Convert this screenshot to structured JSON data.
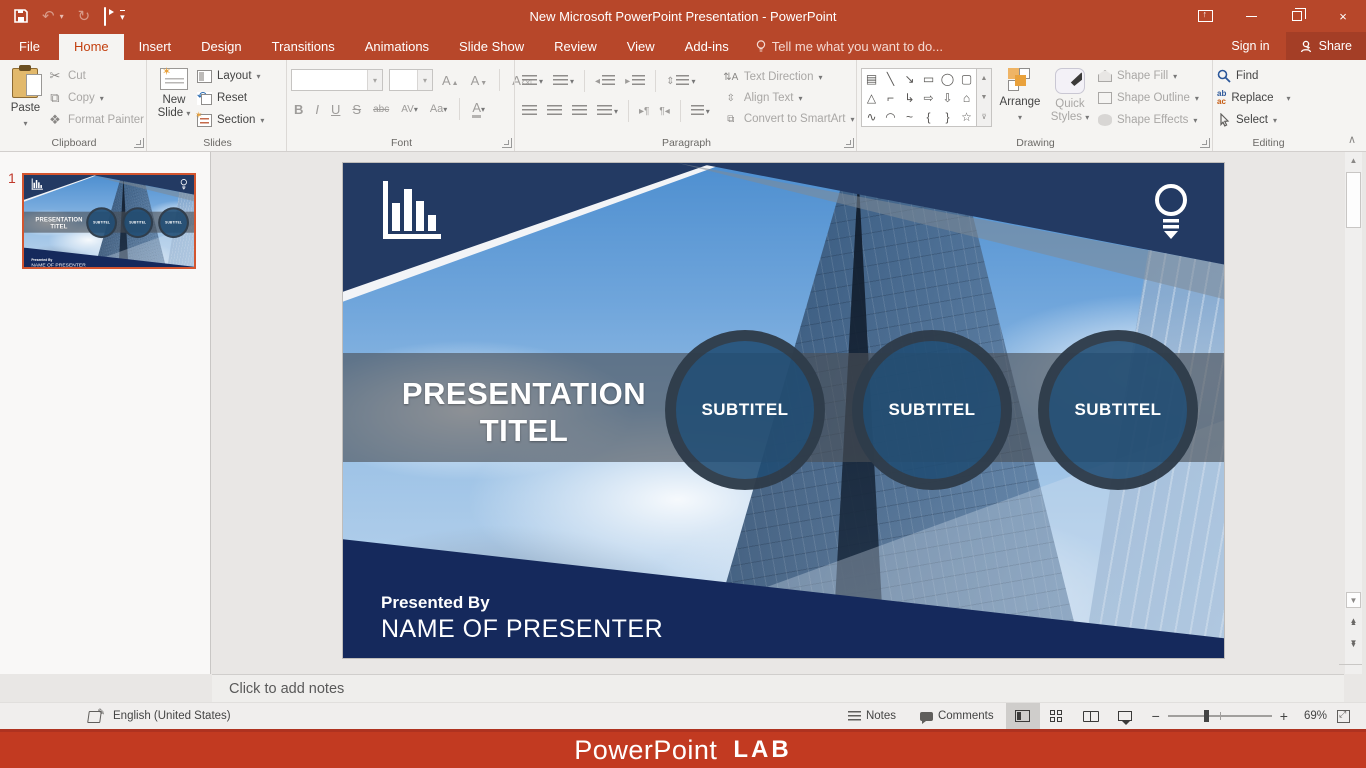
{
  "titlebar": {
    "title": "New Microsoft PowerPoint Presentation - PowerPoint",
    "sign_in": "Sign in",
    "share": "Share"
  },
  "tabs": [
    "File",
    "Home",
    "Insert",
    "Design",
    "Transitions",
    "Animations",
    "Slide Show",
    "Review",
    "View",
    "Add-ins"
  ],
  "tellme": "Tell me what you want to do...",
  "ribbon": {
    "clipboard": {
      "label": "Clipboard",
      "paste": "Paste",
      "cut": "Cut",
      "copy": "Copy",
      "format_painter": "Format Painter"
    },
    "slides": {
      "label": "Slides",
      "new_slide_1": "New",
      "new_slide_2": "Slide",
      "layout": "Layout",
      "reset": "Reset",
      "section": "Section"
    },
    "font": {
      "label": "Font",
      "bold": "B",
      "italic": "I",
      "underline": "U",
      "strike": "S",
      "abc": "abc",
      "av": "AV",
      "aa": "Aa",
      "color": "A",
      "grow": "A",
      "shrink": "A",
      "clear": "A"
    },
    "paragraph": {
      "label": "Paragraph",
      "text_direction": "Text Direction",
      "align_text": "Align Text",
      "convert": "Convert to SmartArt"
    },
    "drawing": {
      "label": "Drawing",
      "arrange": "Arrange",
      "quick_styles_1": "Quick",
      "quick_styles_2": "Styles",
      "shape_fill": "Shape Fill",
      "shape_outline": "Shape Outline",
      "shape_effects": "Shape Effects",
      "shapes": [
        "▤",
        "╲",
        "↘",
        "▭",
        "◯",
        "▢",
        "△",
        "⌐",
        "↳",
        "⇨",
        "⇩",
        "⌂",
        "∿",
        "◠",
        "~",
        "{",
        "}",
        "☆"
      ]
    },
    "editing": {
      "label": "Editing",
      "find": "Find",
      "replace": "Replace",
      "select": "Select"
    }
  },
  "slide": {
    "number": "1",
    "title_line1": "PRESENTATION",
    "title_line2": "TITEL",
    "subtitles": [
      "SUBTITEL",
      "SUBTITEL",
      "SUBTITEL"
    ],
    "presented_by": "Presented By",
    "presenter": "NAME OF PRESENTER"
  },
  "notes": {
    "placeholder": "Click to add notes"
  },
  "statusbar": {
    "language": "English (United States)",
    "notes": "Notes",
    "comments": "Comments",
    "zoom": "69%"
  },
  "footer": {
    "brand": "PowerPoint",
    "suffix": "LAB"
  },
  "colors": {
    "accent": "#B7472A",
    "footer_red": "#C23A21",
    "navy": "#233A63",
    "selection": "#D3552F"
  }
}
